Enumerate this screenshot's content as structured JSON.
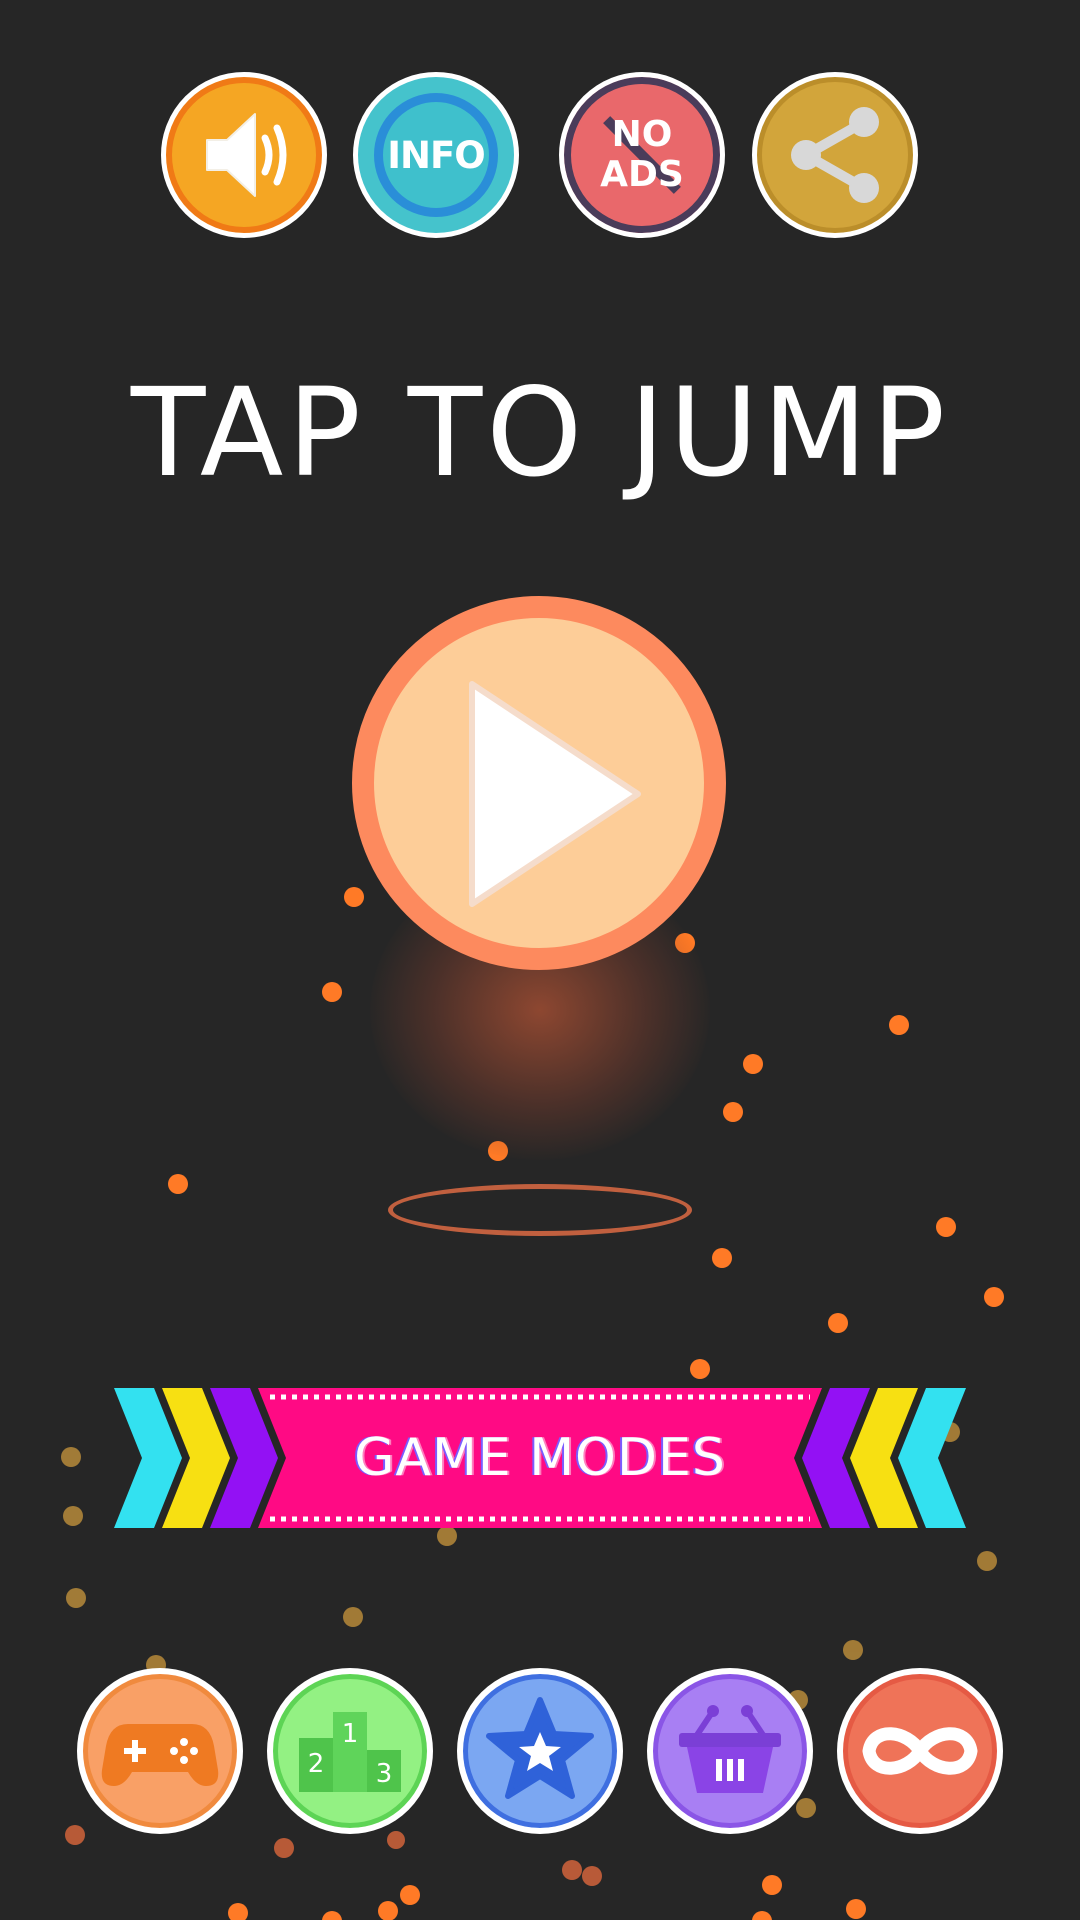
{
  "title": "TAP TO JUMP",
  "top_buttons": {
    "sound": {
      "icon": "speaker-icon"
    },
    "info": {
      "label": "INFO",
      "icon": "info-badge-icon"
    },
    "no_ads": {
      "line1": "NO",
      "line2": "ADS",
      "icon": "no-ads-icon"
    },
    "share": {
      "icon": "share-icon"
    }
  },
  "play": {
    "icon": "play-icon"
  },
  "game_modes": {
    "label": "GAME MODES"
  },
  "bottom_buttons": [
    {
      "name": "games",
      "icon": "gamepad-icon"
    },
    {
      "name": "leaderboard",
      "icon": "podium-icon",
      "places": [
        "1",
        "2",
        "3"
      ]
    },
    {
      "name": "favorites",
      "icon": "star-icon"
    },
    {
      "name": "shop",
      "icon": "basket-icon"
    },
    {
      "name": "endless",
      "icon": "infinity-icon"
    }
  ],
  "colors": {
    "background": "#262626",
    "play_fill": "#fdcd98",
    "play_ring": "#fd8a5e",
    "banner": "#ff0a84",
    "particle": "#ff7a26",
    "chevron_cyan": "#33e1f0",
    "chevron_yellow": "#f7e012",
    "chevron_purple": "#9311f4"
  }
}
